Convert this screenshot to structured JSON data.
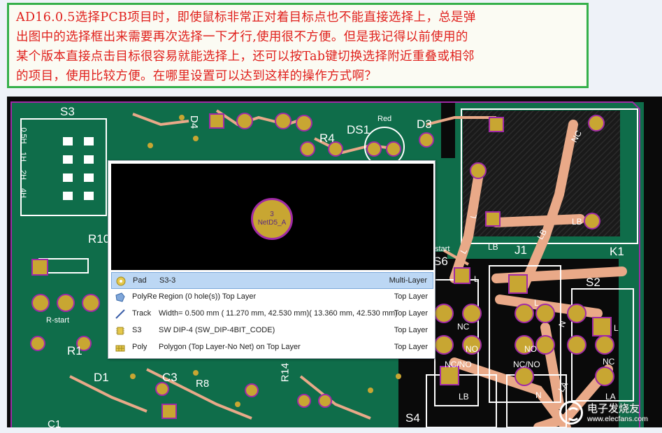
{
  "question": {
    "lines": [
      "AD16.0.5选择PCB项目时，即使鼠标非常正对着目标点也不能直接选择上，总是弹",
      "出图中的选择框出来需要再次选择一下才行,使用很不方便。但是我记得以前使用的",
      "某个版本直接点击目标很容易就能选择上，还可以按Tab键切换选择附近重叠或相邻",
      "的项目，使用比较方便。在哪里设置可以达到这样的操作方式啊？"
    ],
    "text_color": "#e0201c",
    "border_color": "#35b04a"
  },
  "pcb": {
    "colors": {
      "board": "#0f6d4a",
      "copper_pad": "#c8a632",
      "trace": "#e9a988",
      "silk": "#ffffff",
      "outline": "#a02aa6"
    },
    "designators": [
      "S3",
      "D4",
      "R4",
      "DS1",
      "D3",
      "Red",
      "R10",
      "R-start",
      "R1",
      "D1",
      "C3",
      "R8",
      "R14",
      "C1",
      "S4",
      "J1",
      "S6",
      "S2",
      "K1",
      "start"
    ],
    "switch_labels": [
      "0.5H",
      "1H",
      "2H",
      "4H"
    ],
    "pin_labels": [
      "NC",
      "NC",
      "NO",
      "NO",
      "NC/NO",
      "NC/NO",
      "NC/NO",
      "LB",
      "LB",
      "LB",
      "LB",
      "LA",
      "LA",
      "L",
      "L",
      "L",
      "L",
      "L",
      "N",
      "NC",
      "N"
    ]
  },
  "popup": {
    "preview": {
      "pad_number": "3",
      "pad_net": "NetD5_A"
    },
    "items": [
      {
        "icon": "pad-icon",
        "kind": "Pad",
        "description": "S3-3",
        "layer": "Multi-Layer",
        "selected": true
      },
      {
        "icon": "region-icon",
        "kind": "PolyRe",
        "description": "Region (0 hole(s)) Top Layer",
        "layer": "Top Layer",
        "selected": false
      },
      {
        "icon": "track-icon",
        "kind": "Track",
        "description": "Width=  0.500 mm ( 11.270 mm, 42.530 mm)( 13.360 mm, 42.530 mm)",
        "layer": "Top Layer",
        "selected": false
      },
      {
        "icon": "component-icon",
        "kind": "S3",
        "description": "SW DIP-4 (SW_DIP-4BIT_CODE)",
        "layer": "Top Layer",
        "selected": false
      },
      {
        "icon": "polygon-icon",
        "kind": "Poly",
        "description": "Polygon  (Top Layer-No Net) on Top Layer",
        "layer": "Top Layer",
        "selected": false
      }
    ]
  },
  "watermark": {
    "cn": "电子发烧友",
    "url": "www.elecfans.com"
  }
}
